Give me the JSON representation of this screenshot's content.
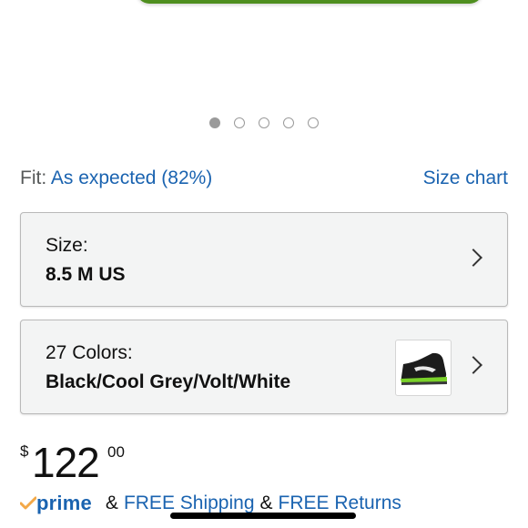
{
  "carousel": {
    "count": 5,
    "active_index": 0
  },
  "fit": {
    "label": "Fit:",
    "value": "As expected (82%)",
    "size_chart": "Size chart"
  },
  "size_selector": {
    "label": "Size:",
    "value": "8.5 M US"
  },
  "color_selector": {
    "label": "27 Colors:",
    "value": "Black/Cool Grey/Volt/White"
  },
  "price": {
    "symbol": "$",
    "whole": "122",
    "fraction": "00"
  },
  "shipping": {
    "prime": "prime",
    "amp1": "&",
    "free_shipping": "FREE Shipping",
    "amp2": "&",
    "free_returns": "FREE Returns"
  },
  "colors": {
    "link": "#1a63b0",
    "prime_check": "#f3a847",
    "box_bg": "#f3f4f4"
  }
}
